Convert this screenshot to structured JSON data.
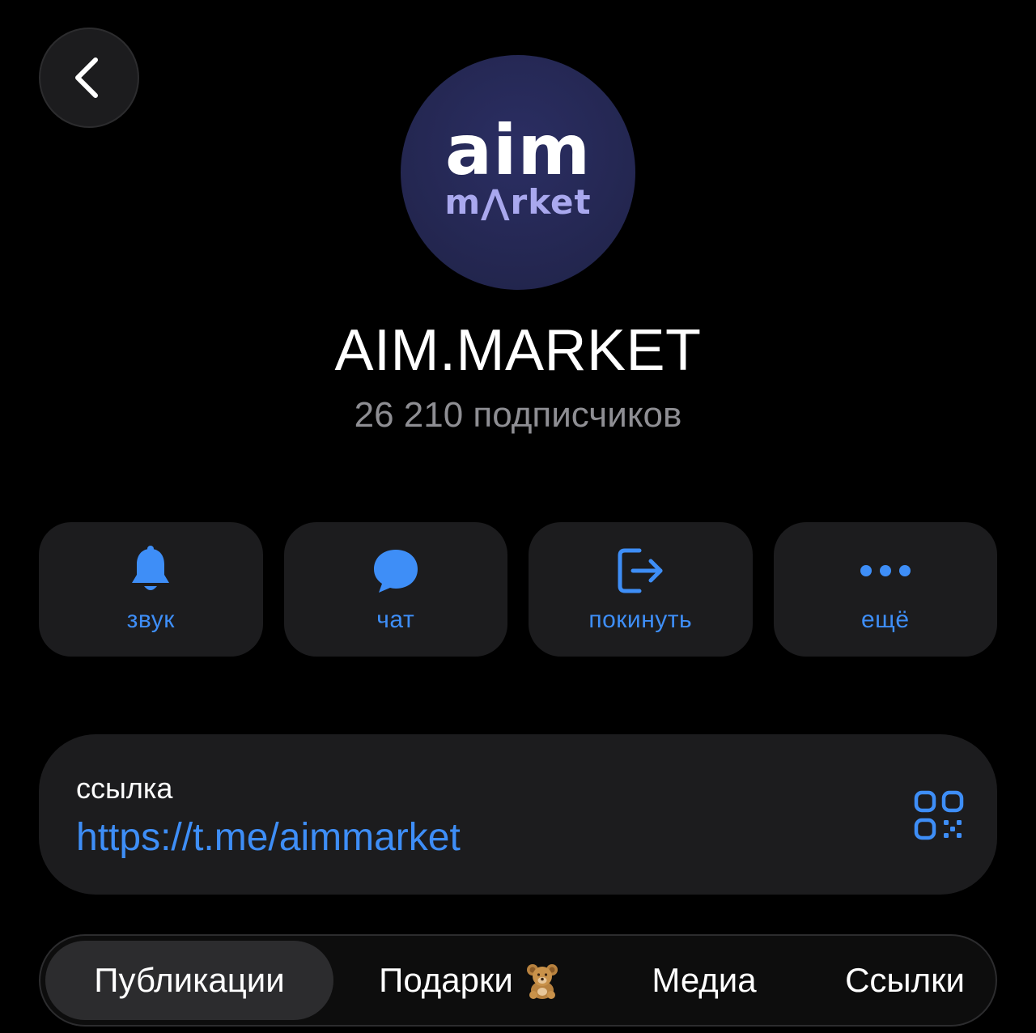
{
  "header": {
    "back_icon": "chevron-left-icon"
  },
  "channel": {
    "avatar_logo_top": "aim",
    "avatar_logo_bottom": "m⋀rket",
    "name": "AIM.MARKET",
    "subscribers": "26 210 подписчиков"
  },
  "actions": [
    {
      "label": "звук",
      "icon": "bell-icon"
    },
    {
      "label": "чат",
      "icon": "chat-bubble-icon"
    },
    {
      "label": "покинуть",
      "icon": "leave-icon"
    },
    {
      "label": "ещё",
      "icon": "more-dots-icon"
    }
  ],
  "link": {
    "caption": "ссылка",
    "url": "https://t.me/aimmarket",
    "qr_icon": "qr-code-icon"
  },
  "tabs": [
    {
      "label": "Публикации",
      "active": true
    },
    {
      "label": "Подарки",
      "emoji_icon": "teddy-bear-icon"
    },
    {
      "label": "Медиа"
    },
    {
      "label": "Ссылки"
    }
  ],
  "colors": {
    "accent": "#3e8ef7",
    "background": "#000000",
    "card": "#1c1c1e",
    "muted_text": "#8e8e93",
    "avatar_bg": "#23264f",
    "logo_secondary": "#a9a8ee"
  }
}
